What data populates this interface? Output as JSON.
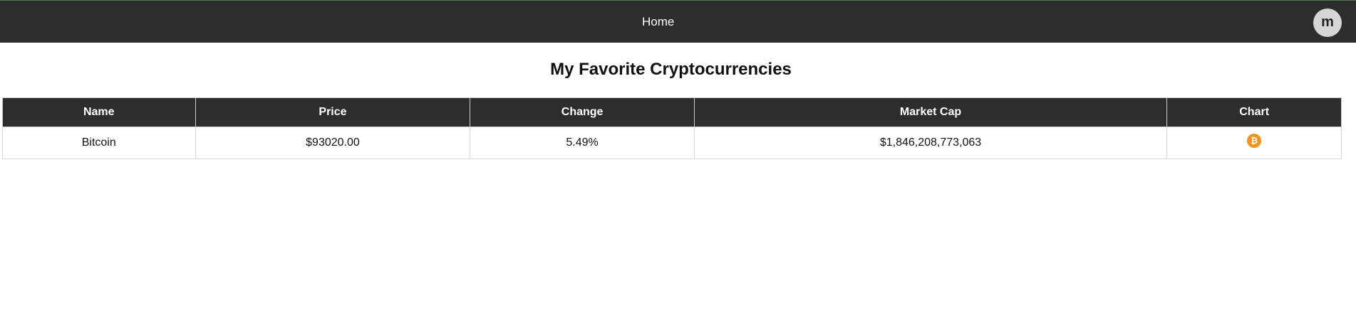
{
  "nav": {
    "home_label": "Home",
    "avatar_initial": "m"
  },
  "page": {
    "title": "My Favorite Cryptocurrencies"
  },
  "table": {
    "headers": [
      "Name",
      "Price",
      "Change",
      "Market Cap",
      "Chart"
    ],
    "rows": [
      {
        "name": "Bitcoin",
        "price": "$93020.00",
        "change": "5.49%",
        "market_cap": "$1,846,208,773,063",
        "chart_icon": "bitcoin-icon",
        "chart_glyph": "₿"
      }
    ]
  },
  "colors": {
    "navbar_bg": "#2d2d2d",
    "change_positive": "#2b7a1c",
    "bitcoin_orange": "#f7931a"
  }
}
